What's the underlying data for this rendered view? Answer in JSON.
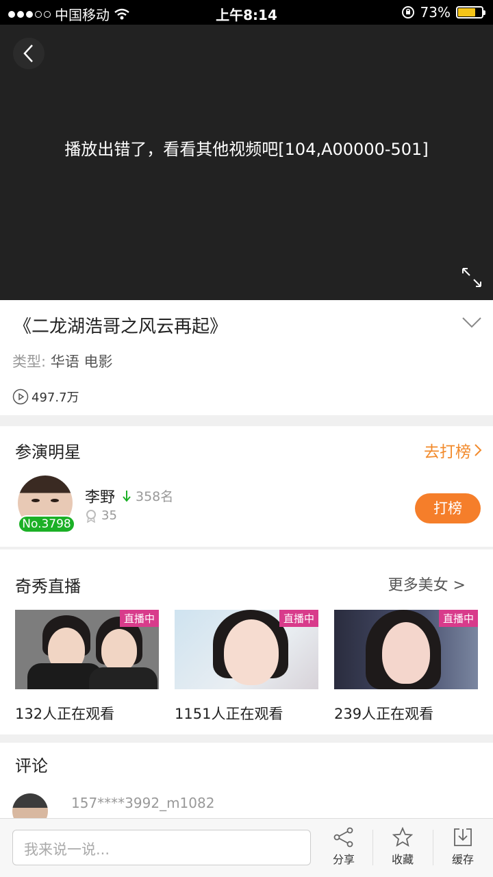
{
  "status_bar": {
    "carrier": "中国移动",
    "time": "上午8:14",
    "battery_percent": "73%",
    "battery_level": 0.73
  },
  "player": {
    "error_message": "播放出错了，看看其他视频吧[104,A00000-501]"
  },
  "video": {
    "title": "《二龙湖浩哥之风云再起》",
    "genre_label": "类型:",
    "genre_value": "华语 电影",
    "play_count": "497.7万"
  },
  "cast": {
    "section_title": "参演明星",
    "rank_link": "去打榜",
    "star": {
      "name": "李野",
      "rank_change": "358名",
      "popularity": "35",
      "number_badge": "No.3798",
      "vote_button": "打榜"
    }
  },
  "live": {
    "section_title": "奇秀直播",
    "more_link": "更多美女 >",
    "badge": "直播中",
    "streams": [
      {
        "viewers": "132人正在观看"
      },
      {
        "viewers": "1151人正在观看"
      },
      {
        "viewers": "239人正在观看"
      }
    ]
  },
  "comments": {
    "section_title": "评论",
    "first_user": "157****3992_m1082"
  },
  "bottom_bar": {
    "input_placeholder": "我来说一说...",
    "share_label": "分享",
    "favorite_label": "收藏",
    "download_label": "缓存"
  },
  "colors": {
    "accent_orange": "#f57e2a",
    "badge_green": "#1bb026",
    "live_pink": "#d83b8b"
  }
}
